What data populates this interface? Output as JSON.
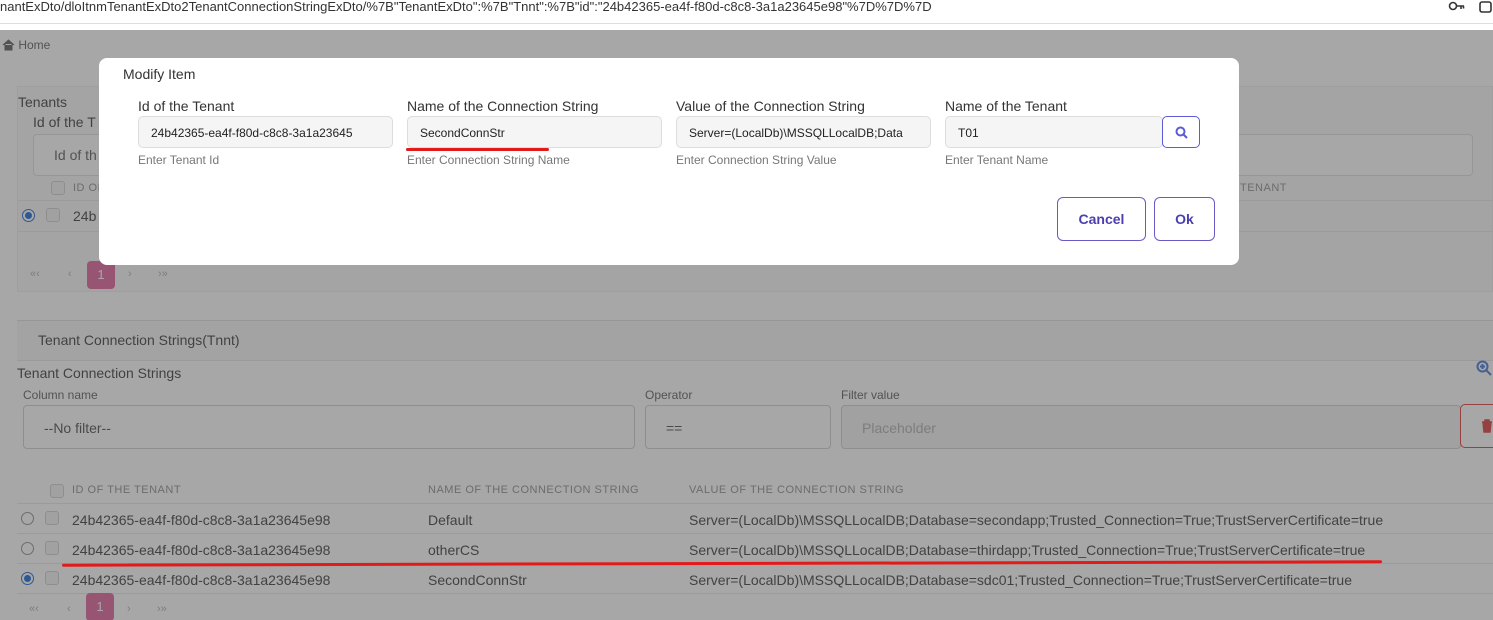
{
  "browser": {
    "url": "nantExDto/dloItnmTenantExDto2TenantConnectionStringExDto/%7B\"TenantExDto\":%7B\"Tnnt\":%7B\"id\":\"24b42365-ea4f-f80d-c8c8-3a1a23645e98\"%7D%7D%7D"
  },
  "breadcrumb": {
    "home": "Home"
  },
  "tenants_panel": {
    "title": "Tenants",
    "subtitle": "Id of the T",
    "filter_text": "Id of th",
    "col_id": "ID OF",
    "col_name": "TENANT",
    "row_id_partial": "24b",
    "page": "1"
  },
  "modal": {
    "title": "Modify Item",
    "fields": [
      {
        "label": "Id of the Tenant",
        "value": "24b42365-ea4f-f80d-c8c8-3a1a23645",
        "hint": "Enter Tenant Id"
      },
      {
        "label": "Name of the Connection String",
        "value": "SecondConnStr",
        "hint": "Enter Connection String Name"
      },
      {
        "label": "Value of the Connection String",
        "value": "Server=(LocalDb)\\MSSQLLocalDB;Data",
        "hint": "Enter Connection String Value"
      },
      {
        "label": "Name of the Tenant",
        "value": "T01",
        "hint": "Enter Tenant Name"
      }
    ],
    "cancel_label": "Cancel",
    "ok_label": "Ok"
  },
  "conn_panel": {
    "header": "Tenant Connection Strings(Tnnt)",
    "title": "Tenant Connection Strings",
    "column_name_label": "Column name",
    "operator_label": "Operator",
    "filter_value_label": "Filter value",
    "column_select_value": "--No filter--",
    "operator_value": "==",
    "filter_placeholder": "Placeholder",
    "columns": [
      "ID OF THE TENANT",
      "NAME OF THE CONNECTION STRING",
      "VALUE OF THE CONNECTION STRING"
    ],
    "rows": [
      {
        "id": "24b42365-ea4f-f80d-c8c8-3a1a23645e98",
        "name": "Default",
        "value": "Server=(LocalDb)\\MSSQLLocalDB;Database=secondapp;Trusted_Connection=True;TrustServerCertificate=true",
        "selected": false
      },
      {
        "id": "24b42365-ea4f-f80d-c8c8-3a1a23645e98",
        "name": "otherCS",
        "value": "Server=(LocalDb)\\MSSQLLocalDB;Database=thirdapp;Trusted_Connection=True;TrustServerCertificate=true",
        "selected": false
      },
      {
        "id": "24b42365-ea4f-f80d-c8c8-3a1a23645e98",
        "name": "SecondConnStr",
        "value": "Server=(LocalDb)\\MSSQLLocalDB;Database=sdc01;Trusted_Connection=True;TrustServerCertificate=true",
        "selected": true
      }
    ],
    "page": "1"
  },
  "colors": {
    "accent": "#e05b97",
    "modal_button": "#4b3fb0",
    "annotation": "#e21a1a",
    "radio_selected": "#0a60d8"
  }
}
